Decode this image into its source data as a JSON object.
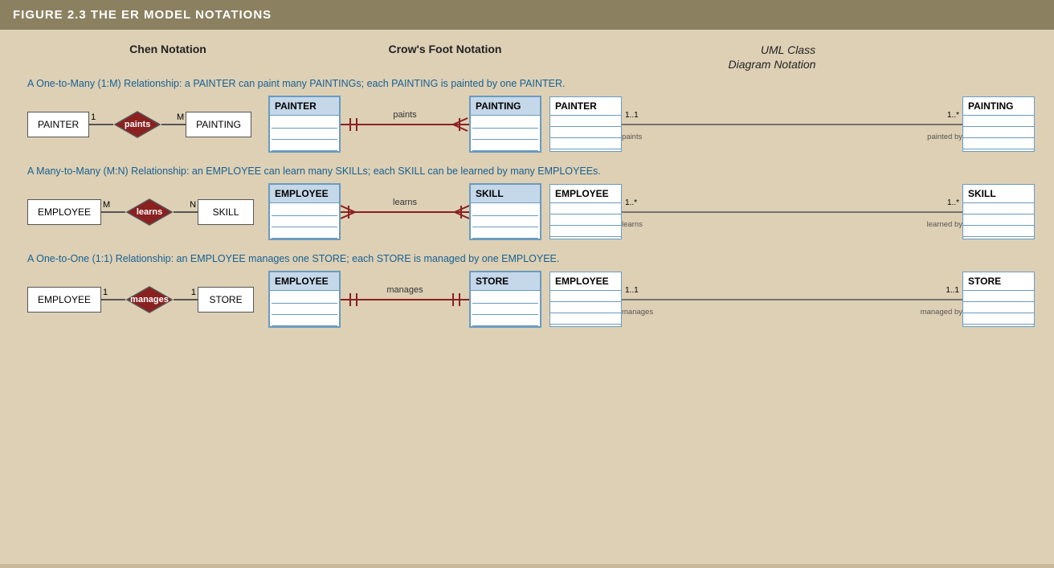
{
  "header": {
    "title": "FIGURE 2.3  THE ER MODEL NOTATIONS"
  },
  "columns": {
    "chen": "Chen Notation",
    "crows": "Crow's Foot Notation",
    "uml": "UML Class\nDiagram Notation"
  },
  "sections": [
    {
      "id": "one-to-many",
      "description": "A One-to-Many (1:M) Relationship: a PAINTER can paint many PAINTINGs; each PAINTING is painted by one PAINTER.",
      "chen": {
        "left_entity": "PAINTER",
        "relationship": "paints",
        "right_entity": "PAINTING",
        "left_label": "1",
        "right_label": "M"
      },
      "crows": {
        "left_entity": "PAINTER",
        "relationship": "paints",
        "right_entity": "PAINTING"
      },
      "uml": {
        "left_entity": "PAINTER",
        "right_entity": "PAINTING",
        "left_mult": "1..1",
        "right_mult": "1..*",
        "left_rel": "paints",
        "right_rel": "painted by"
      }
    },
    {
      "id": "many-to-many",
      "description": "A Many-to-Many (M:N) Relationship: an EMPLOYEE can learn many SKILLs; each SKILL can be learned by many EMPLOYEEs.",
      "chen": {
        "left_entity": "EMPLOYEE",
        "relationship": "learns",
        "right_entity": "SKILL",
        "left_label": "M",
        "right_label": "N"
      },
      "crows": {
        "left_entity": "EMPLOYEE",
        "relationship": "learns",
        "right_entity": "SKILL"
      },
      "uml": {
        "left_entity": "EMPLOYEE",
        "right_entity": "SKILL",
        "left_mult": "1..*",
        "right_mult": "1..*",
        "left_rel": "learns",
        "right_rel": "learned by"
      }
    },
    {
      "id": "one-to-one",
      "description": "A One-to-One (1:1) Relationship: an EMPLOYEE manages one STORE; each STORE is managed by one EMPLOYEE.",
      "chen": {
        "left_entity": "EMPLOYEE",
        "relationship": "manages",
        "right_entity": "STORE",
        "left_label": "1",
        "right_label": "1"
      },
      "crows": {
        "left_entity": "EMPLOYEE",
        "relationship": "manages",
        "right_entity": "STORE"
      },
      "uml": {
        "left_entity": "EMPLOYEE",
        "right_entity": "STORE",
        "left_mult": "1..1",
        "right_mult": "1..1",
        "left_rel": "manages",
        "right_rel": "managed by"
      }
    }
  ]
}
